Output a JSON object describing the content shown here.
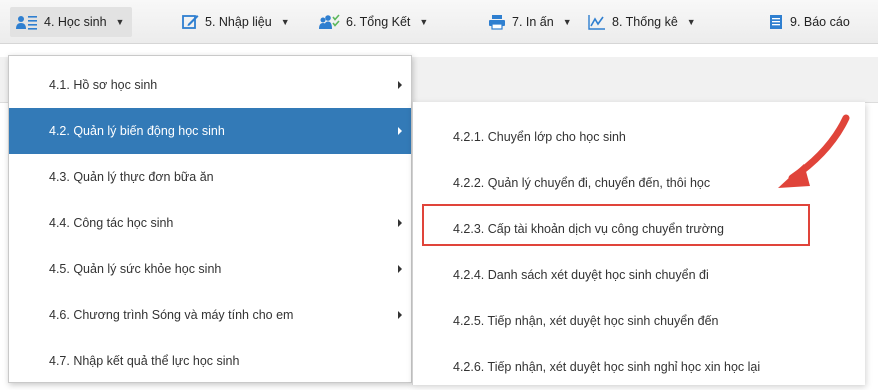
{
  "nav": {
    "items": [
      {
        "label": "4. Học sinh",
        "icon": "students-list-icon"
      },
      {
        "label": "5. Nhập liệu",
        "icon": "edit-icon"
      },
      {
        "label": "6. Tổng Kết",
        "icon": "summary-users-icon"
      },
      {
        "label": "7. In ấn",
        "icon": "printer-icon"
      },
      {
        "label": "8. Thống kê",
        "icon": "line-chart-icon"
      },
      {
        "label": "9. Báo cáo",
        "icon": "report-icon"
      }
    ]
  },
  "menu_level1": {
    "items": [
      {
        "label": "4.1. Hồ sơ học sinh",
        "has_submenu": true
      },
      {
        "label": "4.2. Quản lý biến động học sinh",
        "has_submenu": true,
        "selected": true
      },
      {
        "label": "4.3. Quản lý thực đơn bữa ăn",
        "has_submenu": false
      },
      {
        "label": "4.4. Công tác học sinh",
        "has_submenu": true
      },
      {
        "label": "4.5. Quản lý sức khỏe học sinh",
        "has_submenu": true
      },
      {
        "label": "4.6. Chương trình Sóng và máy tính cho em",
        "has_submenu": true
      },
      {
        "label": "4.7. Nhập kết quả thể lực học sinh",
        "has_submenu": false
      }
    ]
  },
  "menu_level2": {
    "items": [
      {
        "label": "4.2.1. Chuyển lớp cho học sinh"
      },
      {
        "label": "4.2.2. Quản lý chuyển đi, chuyển đến, thôi học"
      },
      {
        "label": "4.2.3. Cấp tài khoản dịch vụ công chuyển trường",
        "highlighted": true
      },
      {
        "label": "4.2.4. Danh sách xét duyệt học sinh chuyển đi"
      },
      {
        "label": "4.2.5. Tiếp nhận, xét duyệt học sinh chuyển đến"
      },
      {
        "label": "4.2.6. Tiếp nhận, xét duyệt học sinh nghỉ học xin học lại"
      }
    ]
  },
  "colors": {
    "selected_bg": "#337ab7",
    "annotation_red": "#e0443a",
    "icon_blue": "#2f7fd0"
  }
}
